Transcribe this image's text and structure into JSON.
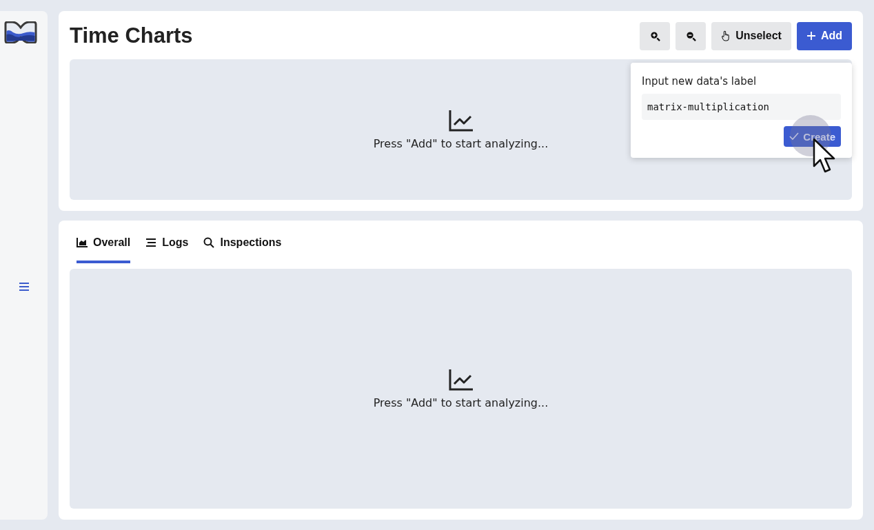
{
  "header": {
    "title": "Time Charts"
  },
  "toolbar": [
    {
      "kind": "zoom-in"
    },
    {
      "kind": "zoom-out"
    },
    {
      "kind": "unselect",
      "label": "Unselect"
    },
    {
      "kind": "add",
      "label": "Add"
    }
  ],
  "popover": {
    "label": "Input new data's label",
    "value": "matrix-multiplication",
    "button": "Create"
  },
  "top_panel": {
    "message": "Press \"Add\" to start analyzing..."
  },
  "tabs": [
    {
      "label": "Overall",
      "selected": true
    },
    {
      "label": "Logs",
      "selected": false
    },
    {
      "label": "Inspections",
      "selected": false
    }
  ],
  "bottom_panel": {
    "message": "Press \"Add\" to start analyzing..."
  }
}
